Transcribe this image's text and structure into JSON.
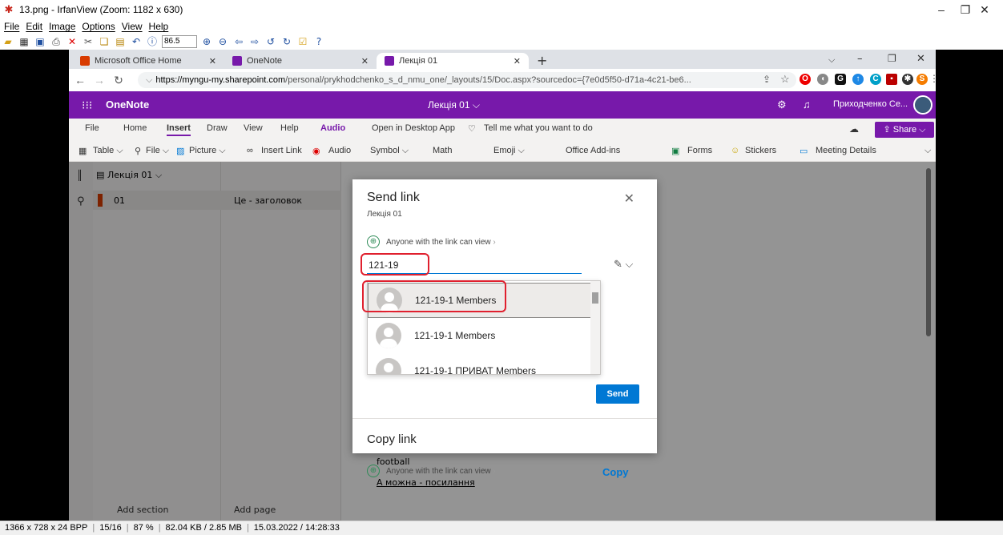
{
  "viewer": {
    "title": "13.png - IrfanView (Zoom: 1182 x 630)",
    "menu": [
      "File",
      "Edit",
      "Image",
      "Options",
      "View",
      "Help"
    ],
    "zoom_value": "86.5",
    "status": {
      "dims": "1366 x 728 x 24 BPP",
      "index": "15/16",
      "zoom": "87 %",
      "size": "82.04 KB / 2.85 MB",
      "datetime": "15.03.2022 / 14:28:33"
    }
  },
  "browser": {
    "tabs": [
      {
        "label": "Microsoft Office Home",
        "color": "#d83b01"
      },
      {
        "label": "OneNote",
        "color": "#7719aa"
      },
      {
        "label": "Лекція 01",
        "color": "#7719aa"
      }
    ],
    "url_host": "https://myngu-my.sharepoint.com",
    "url_path": "/personal/prykhodchenko_s_d_nmu_one/_layouts/15/Doc.aspx?sourcedoc={7e0d5f50-d71a-4c21-be6...",
    "profile_letter": "S"
  },
  "onenote": {
    "app_name": "OneNote",
    "doc_title": "Лекція 01 ⌵",
    "user_name": "Приходченко Се...",
    "ribbon_tabs": [
      "File",
      "Home",
      "Insert",
      "Draw",
      "View",
      "Help",
      "Audio",
      "Open in Desktop App",
      "Tell me what you want to do"
    ],
    "share_label": "Share",
    "ribbon_cmds": [
      "Table ⌵",
      "File ⌵",
      "Picture ⌵",
      "Insert Link",
      "Audio",
      "Symbol ⌵",
      "Math",
      "Emoji ⌵",
      "Office Add-ins",
      "Forms",
      "Stickers",
      "Meeting Details"
    ],
    "notebook": "Лекція 01 ⌵",
    "section": "01",
    "page": "Це - заголовок",
    "add_section": "Add section",
    "add_page": "Add page",
    "content_lines": [
      "football",
      "А можна - посилання"
    ]
  },
  "dialog": {
    "title": "Send link",
    "subtitle": "Лекція 01",
    "permission": "Anyone with the link can view",
    "input_value": "121-19",
    "options": [
      "121-19-1 Members",
      "121-19-1 Members",
      "121-19-1 ПРИВАТ Members"
    ],
    "send_label": "Send",
    "copy_title": "Copy link",
    "copy_permission": "Anyone with the link can view",
    "copy_label": "Copy"
  },
  "colors": {
    "onenote_purple": "#7719aa",
    "primary_blue": "#0078d4",
    "annotation_red": "#e0202e"
  }
}
